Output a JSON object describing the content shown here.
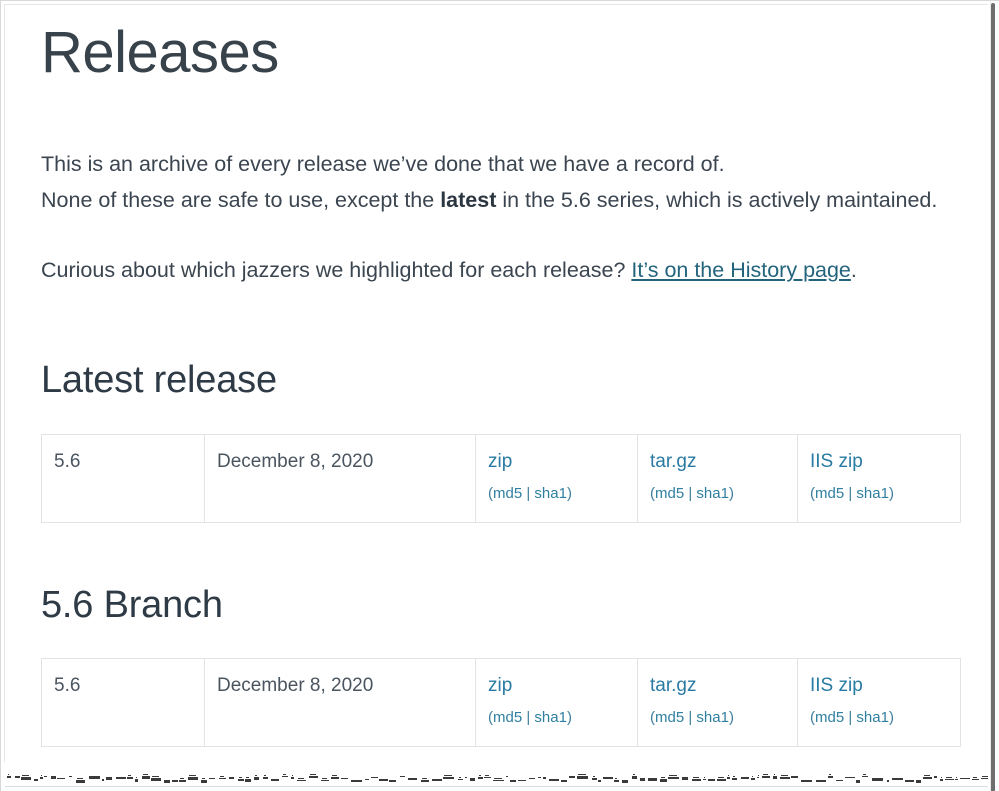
{
  "page": {
    "title": "Releases"
  },
  "intro": {
    "line1": "This is an archive of every release we’ve done that we have a record of.",
    "line2_before": "None of these are safe to use, except the ",
    "line2_bold": "latest",
    "line2_after": " in the 5.6 series, which is actively maintained."
  },
  "curious": {
    "before_link": "Curious about which jazzers we highlighted for each release? ",
    "link_text": "It’s on the History page",
    "after_link": "."
  },
  "sections": [
    {
      "heading": "Latest release",
      "row": {
        "version": "5.6",
        "date": "December 8, 2020",
        "zip_label": "zip",
        "zip_md5": "md5",
        "zip_sha1": "sha1",
        "targz_label": "tar.gz",
        "targz_md5": "md5",
        "targz_sha1": "sha1",
        "iiszip_label": "IIS zip",
        "iiszip_md5": "md5",
        "iiszip_sha1": "sha1"
      }
    },
    {
      "heading": "5.6 Branch",
      "row": {
        "version": "5.6",
        "date": "December 8, 2020",
        "zip_label": "zip",
        "zip_md5": "md5",
        "zip_sha1": "sha1",
        "targz_label": "tar.gz",
        "targz_md5": "md5",
        "targz_sha1": "sha1",
        "iiszip_label": "IIS zip",
        "iiszip_md5": "md5",
        "iiszip_sha1": "sha1"
      }
    }
  ],
  "punctuation": {
    "open_paren": "(",
    "close_paren": ")",
    "pipe": "|"
  },
  "colors": {
    "heading": "#2e3b46",
    "body_text": "#3b4550",
    "inline_link": "#23647d",
    "download_link": "#2a7ba3",
    "hash_link": "#2f7fa0",
    "table_border": "#e3e3e3",
    "scrollbar_thumb": "#6e6e6e",
    "page_background": "#ffffff"
  }
}
